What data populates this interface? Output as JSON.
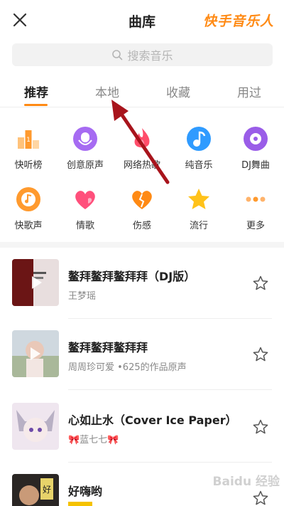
{
  "header": {
    "title": "曲库",
    "brand": "快手音乐人"
  },
  "search": {
    "placeholder": "搜索音乐"
  },
  "tabs": [
    {
      "label": "推荐",
      "active": true
    },
    {
      "label": "本地",
      "active": false
    },
    {
      "label": "收藏",
      "active": false
    },
    {
      "label": "用过",
      "active": false
    }
  ],
  "categories": [
    {
      "label": "快听榜",
      "icon": "chart-icon"
    },
    {
      "label": "创意原声",
      "icon": "mic-icon"
    },
    {
      "label": "网络热歌",
      "icon": "flame-icon"
    },
    {
      "label": "纯音乐",
      "icon": "music-note-icon"
    },
    {
      "label": "DJ舞曲",
      "icon": "vinyl-icon"
    },
    {
      "label": "快歌声",
      "icon": "record-icon"
    },
    {
      "label": "情歌",
      "icon": "heart-icon"
    },
    {
      "label": "伤感",
      "icon": "broken-heart-icon"
    },
    {
      "label": "流行",
      "icon": "star-icon"
    },
    {
      "label": "更多",
      "icon": "more-icon"
    }
  ],
  "songs": [
    {
      "title": "鳌拜鳌拜鳌拜拜（DJ版）",
      "artist": "王梦瑶"
    },
    {
      "title": "鳌拜鳌拜鳌拜拜",
      "artist": "周周珍可爱 •625的作品原声"
    },
    {
      "title": "心如止水（Cover Ice Paper）",
      "artist": "🎀蓝七七🎀"
    },
    {
      "title": "好嗨哟",
      "artist": ""
    }
  ],
  "watermark": "Baidu 经验",
  "colors": {
    "accent": "#ff8a14",
    "arrow": "#a8141c"
  }
}
